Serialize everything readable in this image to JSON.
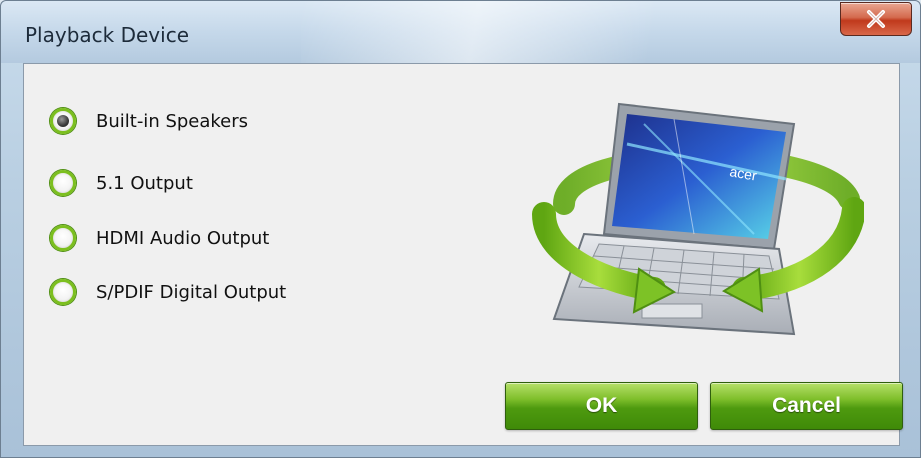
{
  "window": {
    "title": "Playback Device"
  },
  "options": [
    {
      "label": "Built-in Speakers",
      "selected": true
    },
    {
      "label": "5.1 Output",
      "selected": false
    },
    {
      "label": "HDMI Audio Output",
      "selected": false
    },
    {
      "label": "S/PDIF Digital Output",
      "selected": false
    }
  ],
  "buttons": {
    "ok_label": "OK",
    "cancel_label": "Cancel"
  },
  "illustration": {
    "brand_text": "acer"
  },
  "colors": {
    "accent_green": "#7cbf1f",
    "button_green": "#4e9a0f",
    "close_red": "#c0391c"
  },
  "icons": {
    "close": "close-icon",
    "illustration": "laptop-rotate-illustration"
  }
}
